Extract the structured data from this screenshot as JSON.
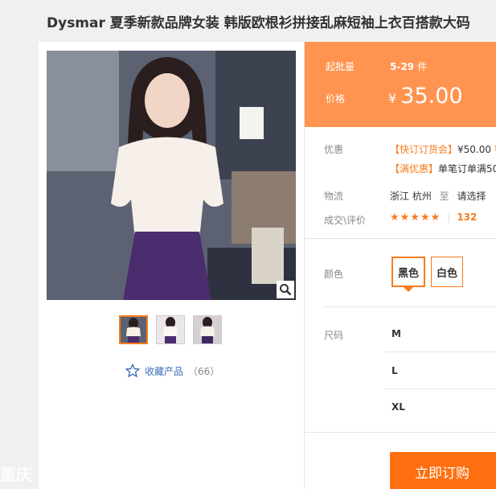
{
  "product": {
    "title": "Dysmar 夏季新款品牌女装 韩版欧根衫拼接乱麻短袖上衣百搭款大码"
  },
  "gallery": {
    "favorite_label": "收藏产品",
    "favorite_count": "（66）",
    "thumbnail_count": 3
  },
  "pricing": {
    "min_order_label": "起批量",
    "min_order_value": "5-29",
    "min_order_unit": "件",
    "price_label": "价格",
    "currency": "¥",
    "price": "35.00"
  },
  "promo": {
    "label": "优惠",
    "line1_tag": "【快订订货会】",
    "line1_text": "¥50.00",
    "line1_cut": "¥",
    "line2_tag": "【满优惠】",
    "line2_text": "单笔订单满50"
  },
  "logistics": {
    "label": "物流",
    "from": "浙江 杭州",
    "to_word": "至",
    "to_select": "请选择"
  },
  "reviews": {
    "label": "成交\\评价",
    "stars": "★★★★★",
    "count": "132"
  },
  "options": {
    "color_label": "颜色",
    "colors": [
      "黑色",
      "白色"
    ],
    "size_label": "尺码",
    "sizes": [
      "M",
      "L",
      "XL"
    ]
  },
  "actions": {
    "buy_now": "立即订购"
  },
  "watermark": "重庆",
  "theme": {
    "accent": "#f87b1d",
    "price_bg": "#ff9450",
    "buy_bg": "#ff6f10"
  }
}
